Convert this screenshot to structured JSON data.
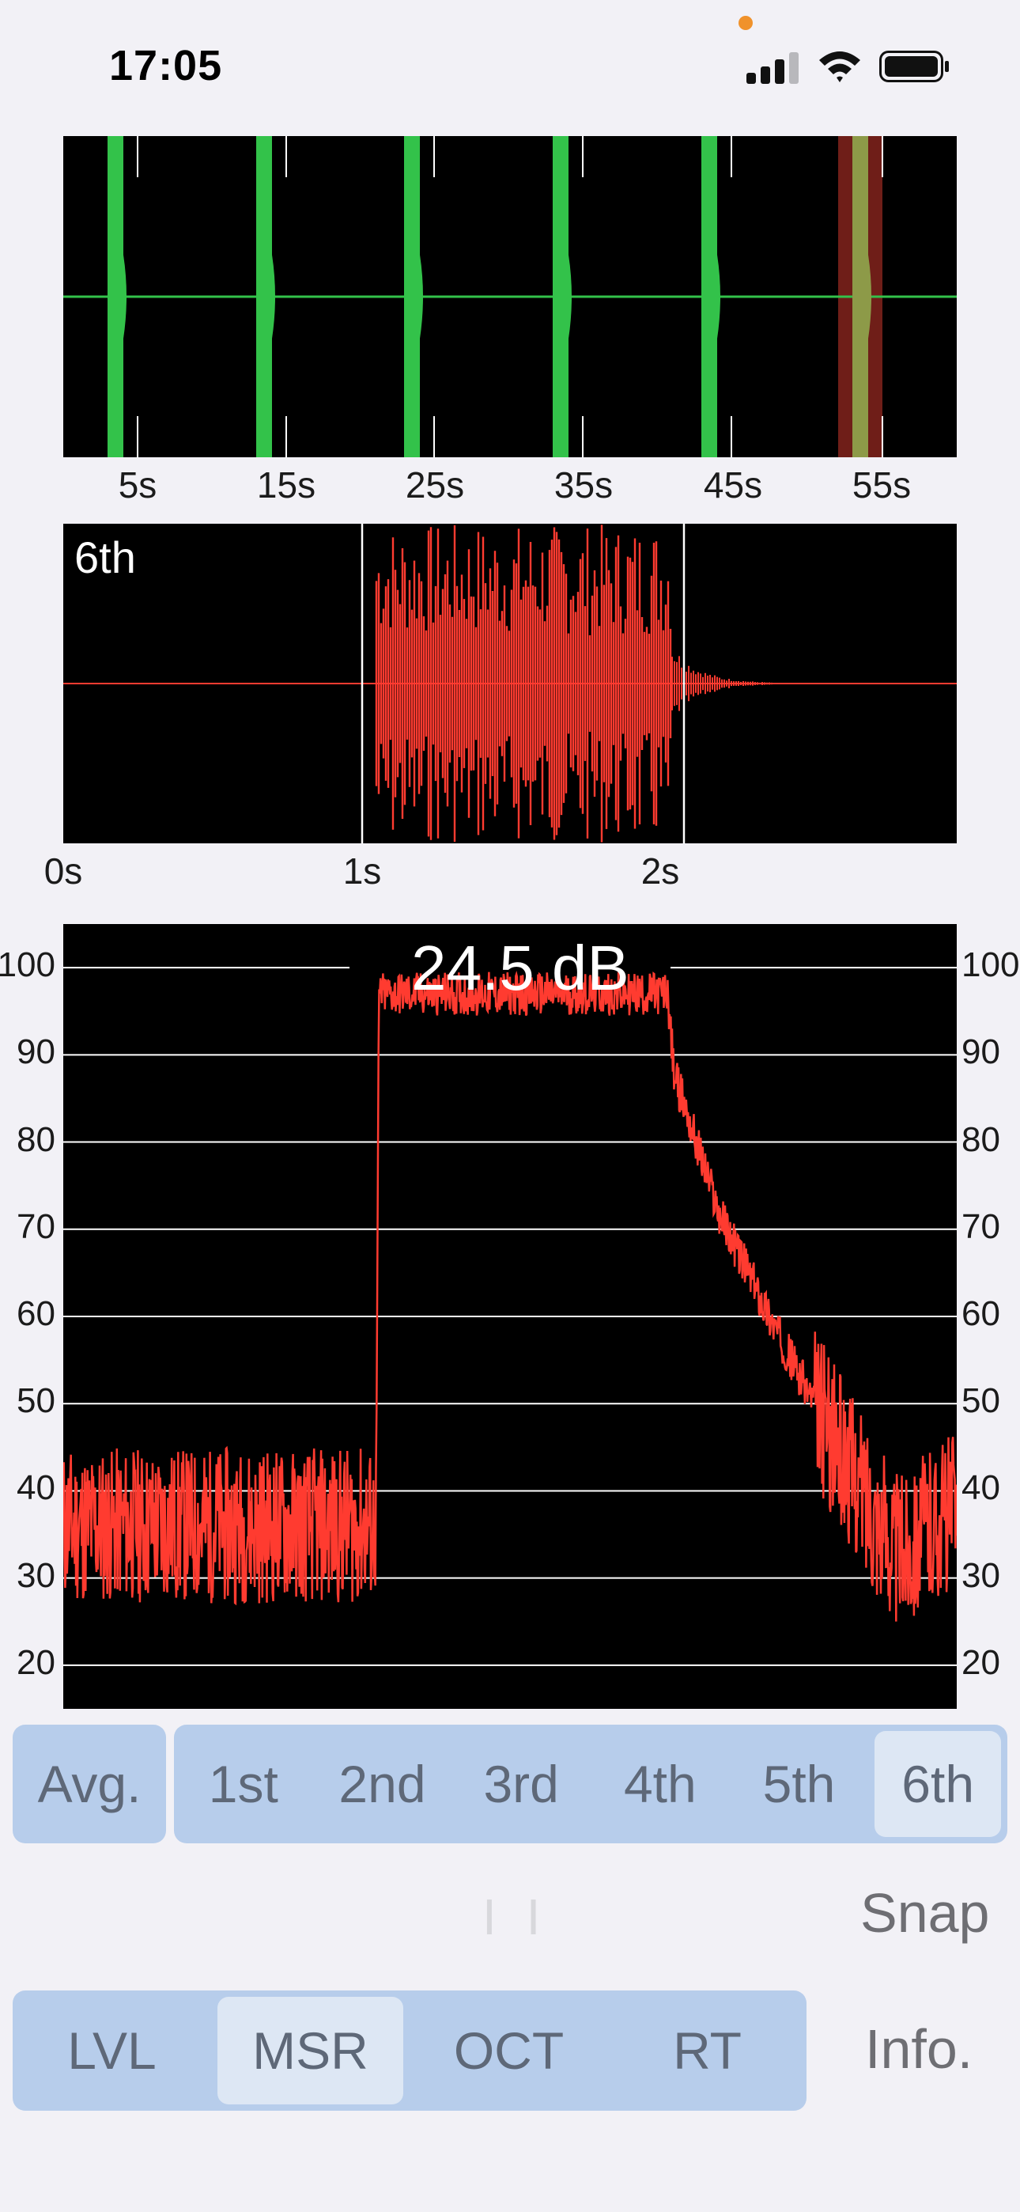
{
  "status": {
    "time": "17:05",
    "colors": {
      "dot": "#f0922b"
    }
  },
  "overview": {
    "ticks": [
      "5s",
      "15s",
      "25s",
      "35s",
      "45s",
      "55s"
    ],
    "selected_index": 5,
    "colors": {
      "burst": "#33c24a",
      "selected_band": "#6f1e18"
    }
  },
  "detail": {
    "name": "6th",
    "ticks": [
      "0s",
      "1s",
      "2s"
    ],
    "color": "#ff3b30"
  },
  "decay": {
    "readout": "24.5 dB",
    "y_ticks": [
      "100",
      "90",
      "80",
      "70",
      "60",
      "50",
      "40",
      "30",
      "20"
    ],
    "color": "#ff3b30"
  },
  "chart_data": {
    "type": "line",
    "title": "24.5 dB",
    "xlabel": "",
    "ylabel": "",
    "ylim": [
      15,
      105
    ],
    "grid": true,
    "series": [
      {
        "x": [
          0,
          1.05,
          1.06,
          2.03,
          2.05,
          2.2,
          2.4,
          2.6,
          2.8,
          2.95,
          3.0
        ],
        "values": [
          36,
          36,
          97,
          97,
          88,
          72,
          58,
          45,
          33,
          37,
          38
        ]
      }
    ]
  },
  "measure_tabs": {
    "avg": "Avg.",
    "items": [
      "1st",
      "2nd",
      "3rd",
      "4th",
      "5th",
      "6th"
    ],
    "selected": "6th"
  },
  "controls": {
    "pause": "I I",
    "snap": "Snap"
  },
  "mode_tabs": {
    "items": [
      "LVL",
      "MSR",
      "OCT",
      "RT"
    ],
    "selected": "MSR",
    "info": "Info."
  }
}
